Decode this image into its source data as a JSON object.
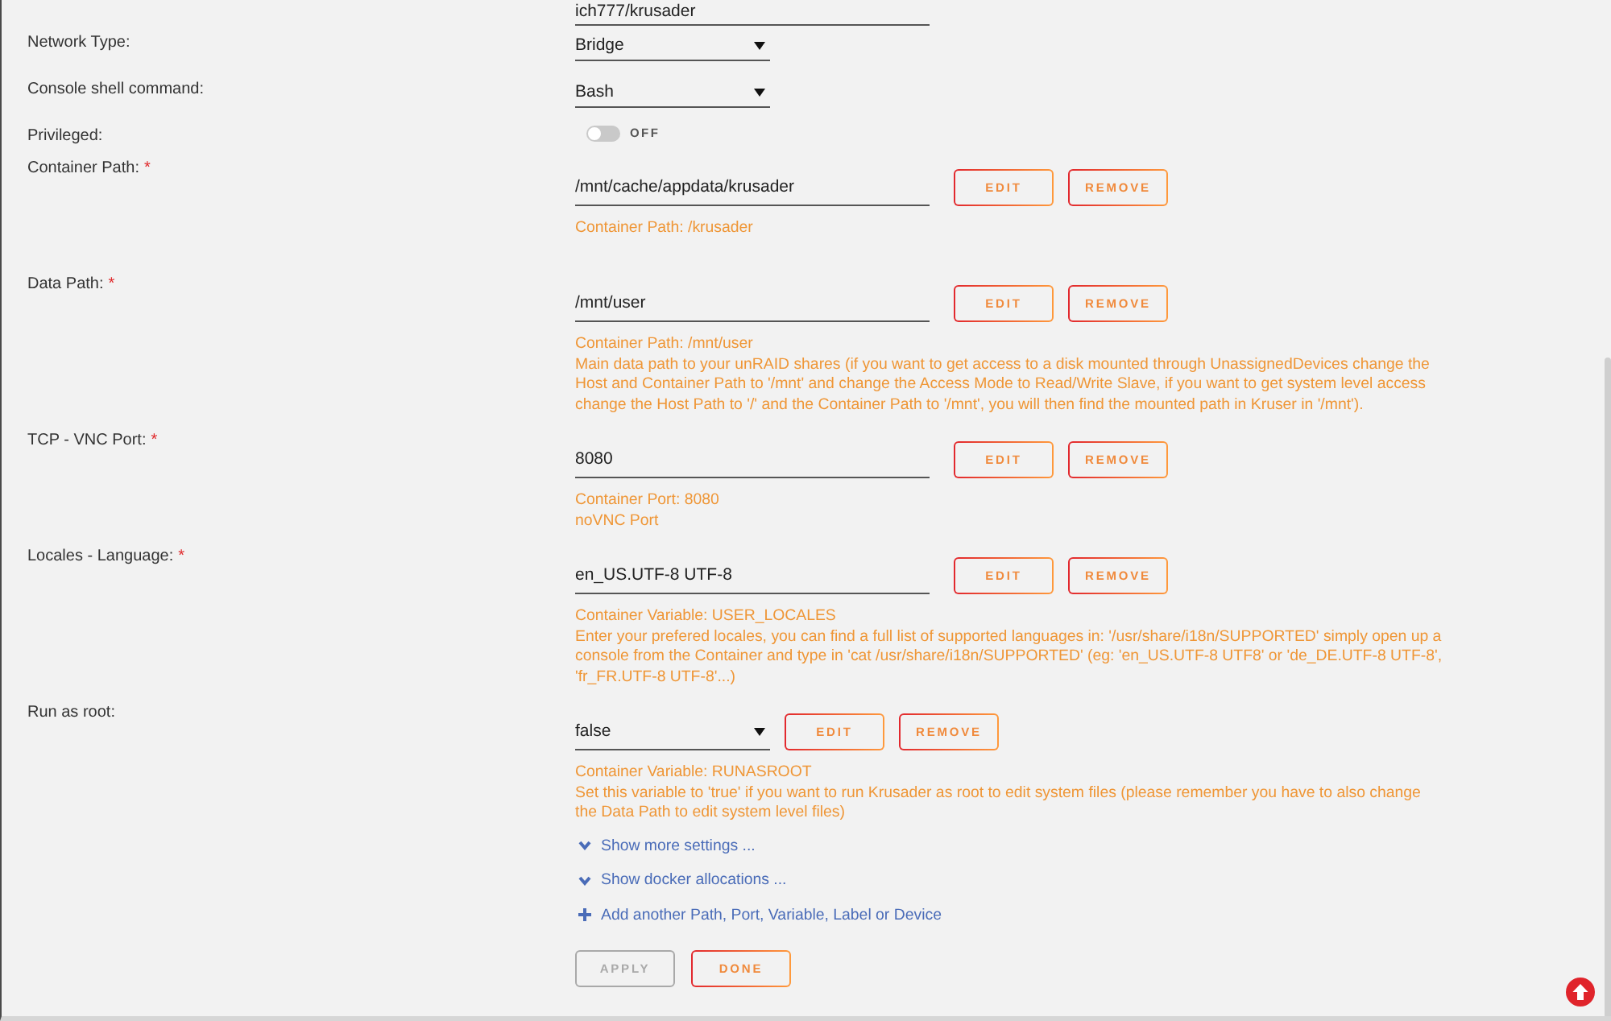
{
  "repository_field": {
    "value": "ich777/krusader"
  },
  "settings": [
    {
      "kind": "select",
      "label": "Network Type:",
      "value": "Bridge"
    },
    {
      "kind": "select",
      "label": "Console shell command:",
      "value": "Bash"
    },
    {
      "kind": "toggle",
      "label": "Privileged:",
      "on": false,
      "state_text": "OFF"
    },
    {
      "kind": "text",
      "label": "Container Path:",
      "required_mark": "*",
      "value": "/mnt/cache/appdata/krusader",
      "actions": [
        "EDIT",
        "REMOVE"
      ],
      "description": {
        "target": "Container Path: /krusader"
      }
    },
    {
      "kind": "text",
      "label": "Data Path:",
      "required_mark": "*",
      "value": "/mnt/user",
      "actions": [
        "EDIT",
        "REMOVE"
      ],
      "description": {
        "target": "Container Path: /mnt/user",
        "help": "Main data path to your unRAID shares (if you want to get access to a disk mounted through UnassignedDevices change the Host and Container Path to '/mnt' and change the Access Mode to Read/Write Slave, if you want to get system level access change the Host Path to '/' and the Container Path to '/mnt', you will then find the mounted path in Kruser in '/mnt')."
      }
    },
    {
      "kind": "text",
      "label": "TCP - VNC Port:",
      "required_mark": "*",
      "value": "8080",
      "actions": [
        "EDIT",
        "REMOVE"
      ],
      "description": {
        "target": "Container Port: 8080",
        "help": "noVNC Port"
      }
    },
    {
      "kind": "text",
      "label": "Locales - Language:",
      "required_mark": "*",
      "value": "en_US.UTF-8 UTF-8",
      "actions": [
        "EDIT",
        "REMOVE"
      ],
      "description": {
        "target": "Container Variable: USER_LOCALES",
        "help": "Enter your prefered locales, you can find a full list of supported languages in: '/usr/share/i18n/SUPPORTED' simply open up a console from the Container and type in 'cat /usr/share/i18n/SUPPORTED' (eg: 'en_US.UTF-8 UTF8' or 'de_DE.UTF-8 UTF-8', 'fr_FR.UTF-8 UTF-8'...)"
      }
    },
    {
      "kind": "select",
      "label": "Run as root:",
      "value": "false",
      "actions": [
        "EDIT",
        "REMOVE"
      ],
      "description": {
        "target": "Container Variable: RUNASROOT",
        "help": "Set this variable to 'true' if you want to run Krusader as root to edit system files (please remember you have to also change the Data Path to edit system level files)"
      }
    }
  ],
  "links": [
    {
      "kind": "expand",
      "label": "Show more settings ..."
    },
    {
      "kind": "expand",
      "label": "Show docker allocations ..."
    },
    {
      "kind": "add",
      "label": "Add another Path, Port, Variable, Label or Device"
    }
  ],
  "buttons": [
    {
      "label": "APPLY",
      "disabled": true
    },
    {
      "label": "DONE",
      "disabled": false
    }
  ]
}
